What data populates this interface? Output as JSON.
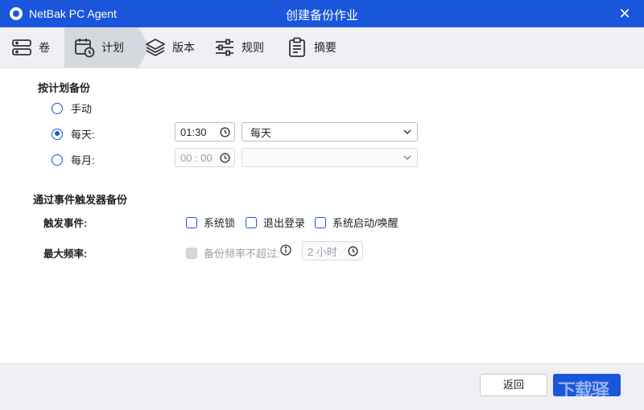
{
  "titlebar": {
    "app_name": "NetBak PC Agent",
    "window_title": "创建备份作业",
    "close_glyph": "✕"
  },
  "steps": [
    {
      "label": "卷",
      "icon": "volume-icon"
    },
    {
      "label": "计划",
      "icon": "calendar-clock-icon"
    },
    {
      "label": "版本",
      "icon": "layers-icon"
    },
    {
      "label": "规则",
      "icon": "sliders-icon"
    },
    {
      "label": "摘要",
      "icon": "clipboard-list-icon"
    }
  ],
  "schedule": {
    "title": "按计划备份",
    "options": [
      {
        "label": "手动",
        "selected": false
      },
      {
        "label": "每天:",
        "selected": true
      },
      {
        "label": "每月:",
        "selected": false
      }
    ],
    "daily": {
      "time": "01:30",
      "frequency": "每天"
    },
    "monthly": {
      "time": "00 : 00",
      "frequency": ""
    }
  },
  "event": {
    "title": "通过事件触发器备份",
    "trigger_label": "触发事件:",
    "triggers": [
      {
        "label": "系统锁",
        "checked": false
      },
      {
        "label": "退出登录",
        "checked": false
      },
      {
        "label": "系统启动/唤醒",
        "checked": false
      }
    ],
    "max_rate_label": "最大频率:",
    "rate_checkbox_label": "备份频率不超过:",
    "rate_value": "2 小时"
  },
  "footer": {
    "back_label": "返回",
    "watermark": "下载驿"
  },
  "colors": {
    "accent": "#1a56db",
    "stepbar_bg": "#eef0f3",
    "active_step_bg": "#d5d9df"
  }
}
